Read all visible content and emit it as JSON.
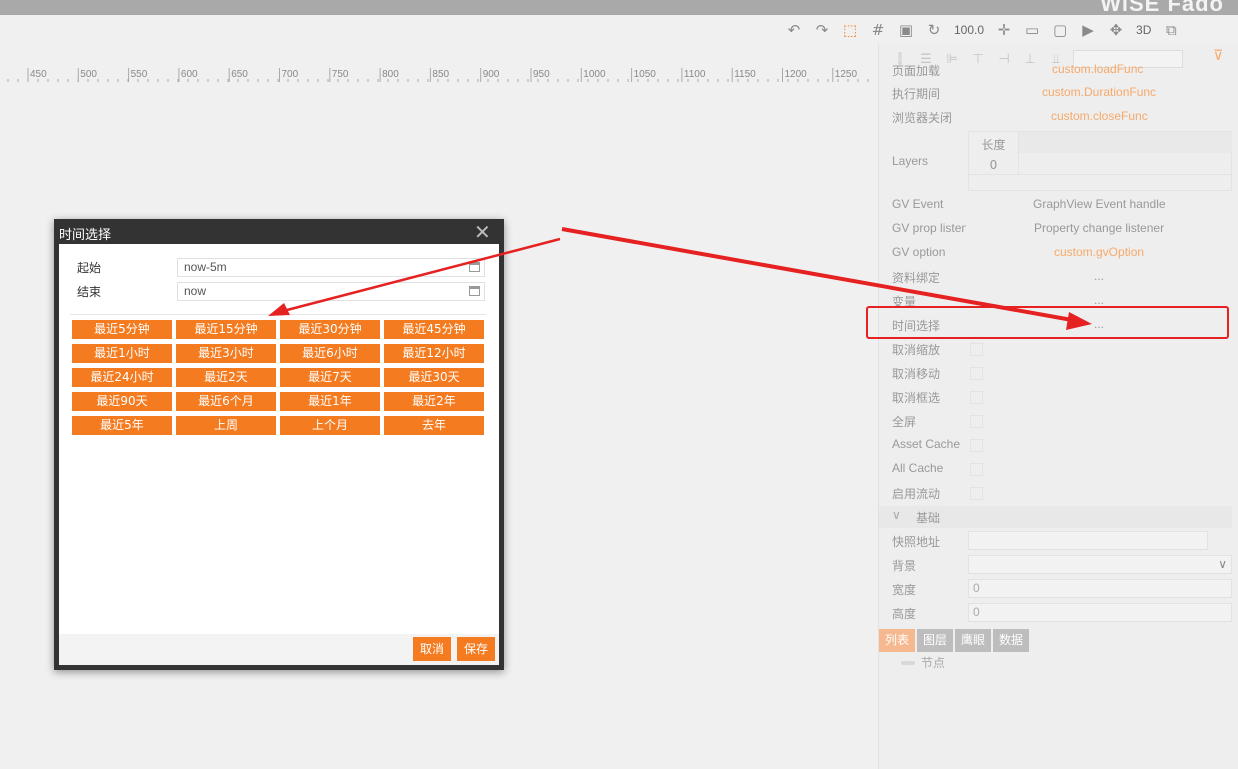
{
  "app": {
    "brand": "WiSE Fado"
  },
  "toolbar": {
    "zoom": "100.0",
    "mode_3d": "3D"
  },
  "ruler": {
    "ticks": [
      "450",
      "500",
      "550",
      "600",
      "650",
      "700",
      "750",
      "800",
      "850",
      "900",
      "950",
      "1000",
      "1050",
      "1100",
      "1150",
      "1200",
      "1250"
    ]
  },
  "panel": {
    "rows": {
      "page_load": {
        "label": "页面加载",
        "value": "custom.loadFunc"
      },
      "exec_period": {
        "label": "执行期间",
        "value": "custom.DurationFunc"
      },
      "browser_close": {
        "label": "浏览器关闭",
        "value": "custom.closeFunc"
      },
      "layers": {
        "label": "Layers",
        "col_header": "长度",
        "count": "0"
      },
      "gv_event": {
        "label": "GV Event",
        "value": "GraphView Event handle"
      },
      "gv_prop": {
        "label": "GV prop listen",
        "value": "Property change listener"
      },
      "gv_option": {
        "label": "GV option",
        "value": "custom.gvOption"
      },
      "data_binding": {
        "label": "资料绑定",
        "value": "..."
      },
      "variables": {
        "label": "变量",
        "value": "..."
      },
      "time_select": {
        "label": "时间选择",
        "value": "..."
      },
      "disable_zoom": {
        "label": "取消缩放"
      },
      "disable_move": {
        "label": "取消移动"
      },
      "disable_select": {
        "label": "取消框选"
      },
      "fullscreen": {
        "label": "全屏"
      },
      "asset_cache": {
        "label": "Asset Cache"
      },
      "all_cache": {
        "label": "All Cache"
      },
      "enable_flow": {
        "label": "启用流动"
      }
    },
    "section_basic": "基础",
    "snapshot": {
      "label": "快照地址",
      "value": ""
    },
    "background": {
      "label": "背景",
      "value": ""
    },
    "width": {
      "label": "宽度",
      "value": "0"
    },
    "height": {
      "label": "高度",
      "value": "0"
    },
    "tabs": [
      "列表",
      "图层",
      "鹰眼",
      "数据"
    ],
    "tree_node": "节点"
  },
  "dialog": {
    "title": "时间选择",
    "start_label": "起始",
    "start_value": "now-5m",
    "end_label": "结束",
    "end_value": "now",
    "presets": [
      "最近5分钟",
      "最近15分钟",
      "最近30分钟",
      "最近45分钟",
      "最近1小时",
      "最近3小时",
      "最近6小时",
      "最近12小时",
      "最近24小时",
      "最近2天",
      "最近7天",
      "最近30天",
      "最近90天",
      "最近6个月",
      "最近1年",
      "最近2年",
      "最近5年",
      "上周",
      "上个月",
      "去年"
    ],
    "cancel": "取消",
    "save": "保存"
  },
  "colors": {
    "accent": "#f47b20",
    "annotation": "#e62121"
  }
}
